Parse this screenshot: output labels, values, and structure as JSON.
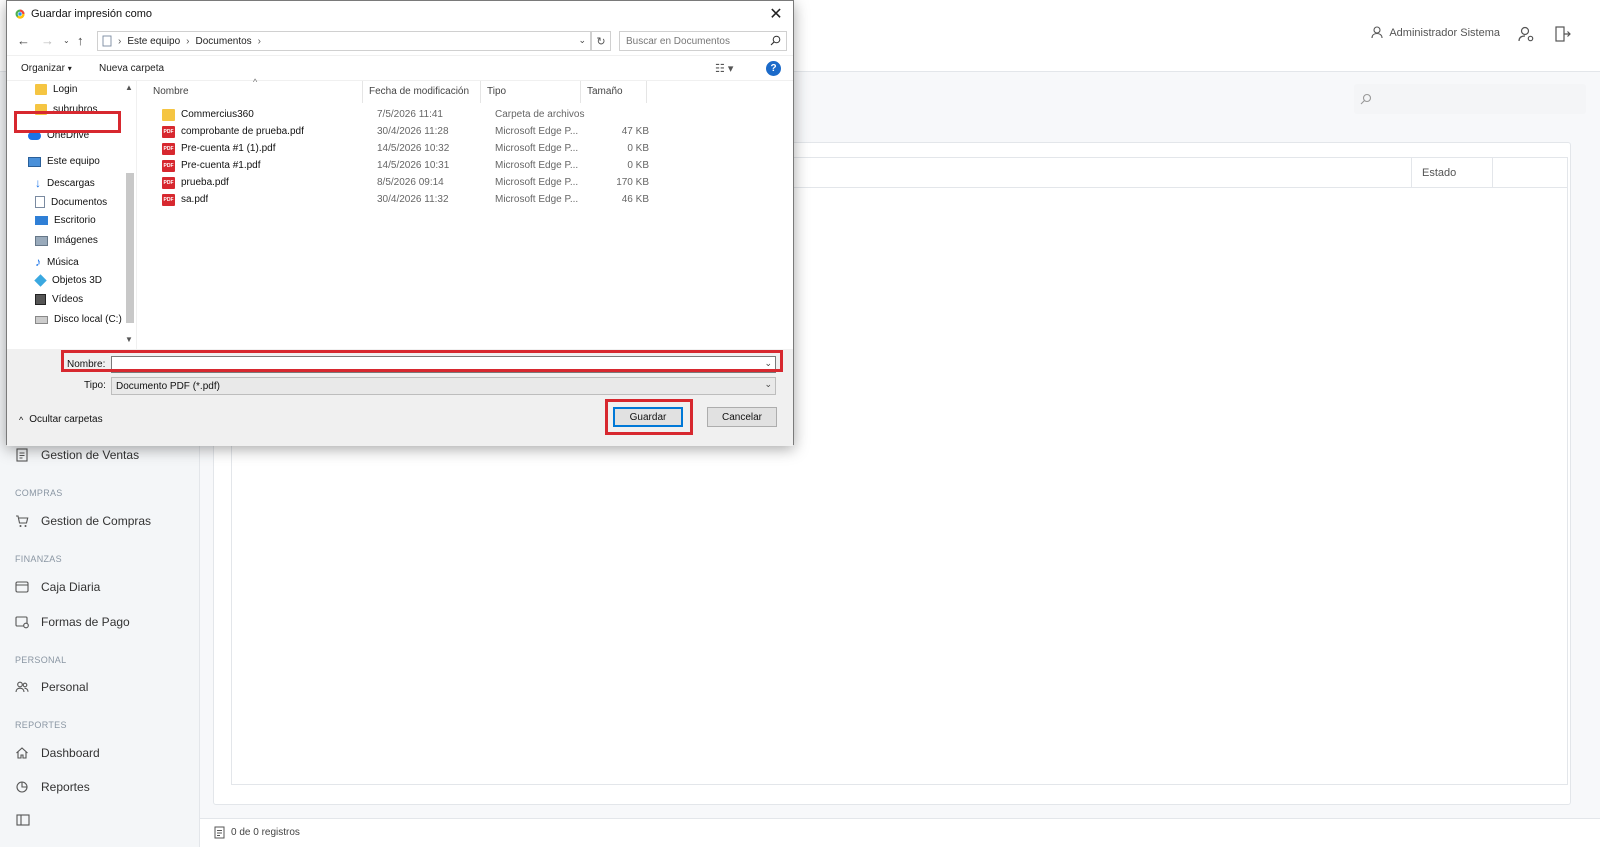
{
  "header": {
    "user_name": "Administrador Sistema"
  },
  "sidebar": {
    "items": [
      {
        "type": "item",
        "label": "Gestion de Ventas",
        "icon": "document-icon"
      },
      {
        "type": "section",
        "label": "COMPRAS"
      },
      {
        "type": "item",
        "label": "Gestion de Compras",
        "icon": "cart-icon"
      },
      {
        "type": "section",
        "label": "FINANZAS"
      },
      {
        "type": "item",
        "label": "Caja Diaria",
        "icon": "cash-icon"
      },
      {
        "type": "item",
        "label": "Formas de Pago",
        "icon": "payment-icon"
      },
      {
        "type": "section",
        "label": "PERSONAL"
      },
      {
        "type": "item",
        "label": "Personal",
        "icon": "people-icon"
      },
      {
        "type": "section",
        "label": "REPORTES"
      },
      {
        "type": "item",
        "label": "Dashboard",
        "icon": "home-icon"
      },
      {
        "type": "item",
        "label": "Reportes",
        "icon": "report-icon"
      }
    ]
  },
  "table": {
    "column_estado": "Estado"
  },
  "footer": {
    "records": "0 de 0 registros"
  },
  "dialog": {
    "title": "Guardar impresión como",
    "breadcrumb": [
      "Este equipo",
      "Documentos"
    ],
    "search_placeholder": "Buscar en Documentos",
    "toolbar": {
      "organize": "Organizar",
      "new_folder": "Nueva carpeta"
    },
    "tree": [
      {
        "label": "Login",
        "icon": "folder-icon"
      },
      {
        "label": "subrubros",
        "icon": "folder-icon"
      },
      {
        "label": "OneDrive",
        "icon": "cloud-icon"
      },
      {
        "label": "Este equipo",
        "icon": "computer-icon"
      },
      {
        "label": "Descargas",
        "icon": "download-icon"
      },
      {
        "label": "Documentos",
        "icon": "document-icon"
      },
      {
        "label": "Escritorio",
        "icon": "desktop-icon"
      },
      {
        "label": "Imágenes",
        "icon": "image-icon"
      },
      {
        "label": "Música",
        "icon": "music-icon"
      },
      {
        "label": "Objetos 3D",
        "icon": "cube-icon"
      },
      {
        "label": "Vídeos",
        "icon": "video-icon"
      },
      {
        "label": "Disco local (C:)",
        "icon": "drive-icon"
      }
    ],
    "columns": {
      "name": "Nombre",
      "date": "Fecha de modificación",
      "type": "Tipo",
      "size": "Tamaño"
    },
    "files": [
      {
        "name": "Commercius360",
        "date": "7/5/2026 11:41",
        "type": "Carpeta de archivos",
        "size": "",
        "icon": "folder-icon"
      },
      {
        "name": "comprobante de prueba.pdf",
        "date": "30/4/2026 11:28",
        "type": "Microsoft Edge P...",
        "size": "47 KB",
        "icon": "pdf-icon"
      },
      {
        "name": "Pre-cuenta #1 (1).pdf",
        "date": "14/5/2026 10:32",
        "type": "Microsoft Edge P...",
        "size": "0 KB",
        "icon": "pdf-icon"
      },
      {
        "name": "Pre-cuenta #1.pdf",
        "date": "14/5/2026 10:31",
        "type": "Microsoft Edge P...",
        "size": "0 KB",
        "icon": "pdf-icon"
      },
      {
        "name": "prueba.pdf",
        "date": "8/5/2026 09:14",
        "type": "Microsoft Edge P...",
        "size": "170 KB",
        "icon": "pdf-icon"
      },
      {
        "name": "sa.pdf",
        "date": "30/4/2026 11:32",
        "type": "Microsoft Edge P...",
        "size": "46 KB",
        "icon": "pdf-icon"
      }
    ],
    "filename_label": "Nombre:",
    "filename_value": "",
    "filetype_label": "Tipo:",
    "filetype_value": "Documento PDF (*.pdf)",
    "hide_folders": "Ocultar carpetas",
    "save_label": "Guardar",
    "cancel_label": "Cancelar"
  },
  "colors": {
    "highlight": "#d7282f",
    "accent": "#0078d7"
  }
}
